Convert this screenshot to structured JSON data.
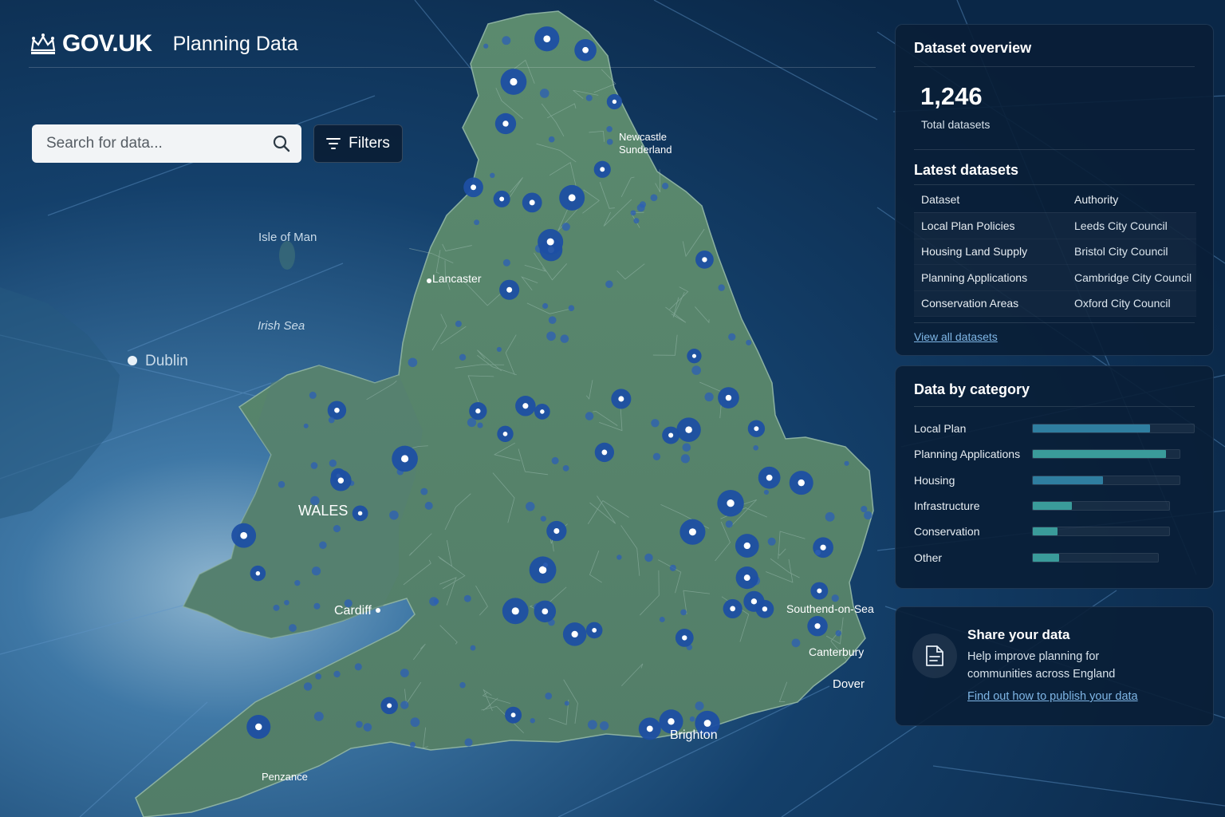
{
  "header": {
    "logo_text": "GOV.UK",
    "service_name": "Planning Data"
  },
  "search": {
    "placeholder": "Search for data...",
    "filters_label": "Filters"
  },
  "map": {
    "labels": {
      "isle_of_man": "Isle of Man",
      "irish_sea": "Irish Sea",
      "dublin": "Dublin",
      "wales": "WALES",
      "cardiff": "Cardiff",
      "brighton": "Brighton",
      "dover": "Dover",
      "canterbury": "Canterbury",
      "southend": "Southend-on-Sea",
      "lancaster": "Lancaster",
      "newcastle": "Newcastle",
      "sunderland": "Sunderland",
      "penzance": "Penzance"
    }
  },
  "overview": {
    "title": "Dataset overview",
    "total": "1,246",
    "total_label": "Total datasets",
    "latest_title": "Latest datasets",
    "columns": [
      "Dataset",
      "Authority"
    ],
    "rows": [
      {
        "dataset": "Local Plan Policies",
        "authority": "Leeds City Council"
      },
      {
        "dataset": "Housing Land Supply",
        "authority": "Bristol City Council"
      },
      {
        "dataset": "Planning Applications",
        "authority": "Cambridge City Council"
      },
      {
        "dataset": "Conservation Areas",
        "authority": "Oxford City Council"
      }
    ],
    "view_all": "View all datasets"
  },
  "categories": {
    "title": "Data by category",
    "items": [
      {
        "label": "Local Plan",
        "value": 0.72,
        "track": 1.0,
        "color": "#2f7ea0"
      },
      {
        "label": "Planning Applications",
        "value": 0.82,
        "track": 0.91,
        "color": "#3a9b9a"
      },
      {
        "label": "Housing",
        "value": 0.43,
        "track": 0.91,
        "color": "#2f7ea0"
      },
      {
        "label": "Infrastructure",
        "value": 0.24,
        "track": 0.85,
        "color": "#3a9b9a"
      },
      {
        "label": "Conservation",
        "value": 0.15,
        "track": 0.85,
        "color": "#3a9b9a"
      },
      {
        "label": "Other",
        "value": 0.16,
        "track": 0.78,
        "color": "#3a9b9a"
      }
    ]
  },
  "share": {
    "title": "Share your data",
    "text": "Help improve planning for communities across England",
    "link": "Find out how to publish your data"
  }
}
